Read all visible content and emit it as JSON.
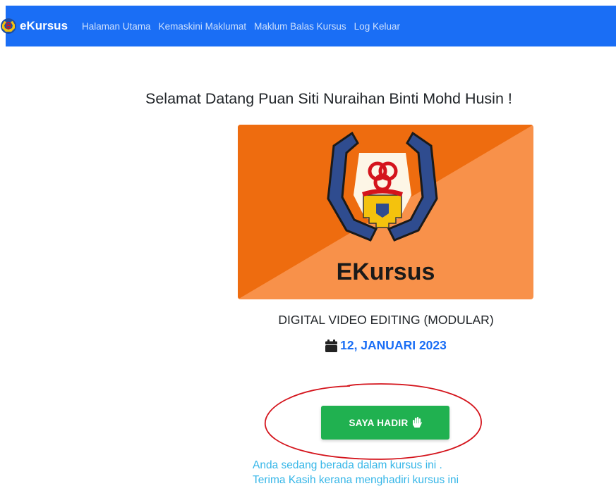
{
  "navbar": {
    "brand": "eKursus",
    "links": [
      {
        "label": "Halaman Utama"
      },
      {
        "label": "Kemaskini Maklumat"
      },
      {
        "label": "Maklum Balas Kursus"
      },
      {
        "label": "Log Keluar"
      }
    ]
  },
  "main": {
    "welcome": "Selamat Datang Puan Siti Nuraihan Binti Mohd Husin !",
    "course_image_text": "EKursus",
    "course_title": "DIGITAL VIDEO EDITING (MODULAR)",
    "course_date": "12, JANUARI 2023",
    "attend_button": "SAYA HADIR",
    "status_line1": "Anda sedang berada dalam kursus ini .",
    "status_line2": "Terima Kasih kerana menghadiri kursus ini"
  },
  "colors": {
    "navbar": "#1a6ef5",
    "button": "#20b150",
    "date": "#1a6ef5",
    "status": "#35b6e8",
    "card_dark": "#ee6c0f",
    "card_light": "#f8914a",
    "annotation": "#d4141c"
  },
  "icons": {
    "brand": "ekursus-logo-icon",
    "date": "calendar-icon",
    "button": "hand-icon"
  }
}
